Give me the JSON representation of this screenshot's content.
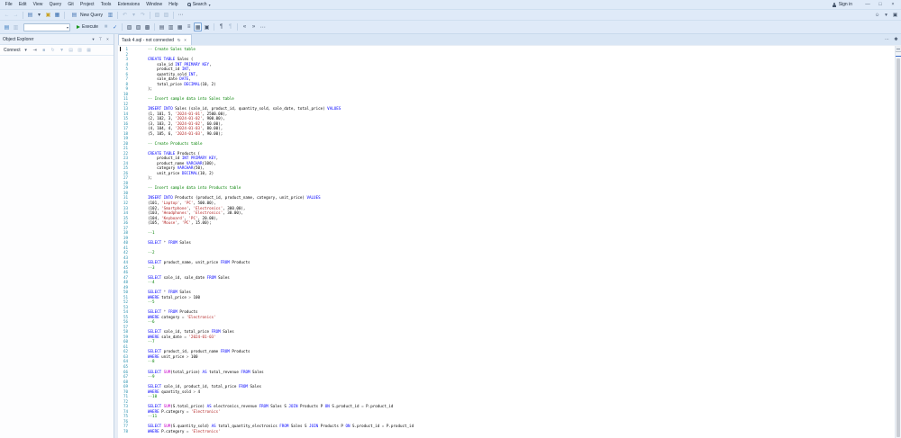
{
  "title_bar": {
    "menus": [
      "File",
      "Edit",
      "View",
      "Query",
      "Git",
      "Project",
      "Tools",
      "Extensions",
      "Window",
      "Help"
    ],
    "search_label": "Search",
    "sign_in_label": "Sign in",
    "window_controls": [
      {
        "n": "minimize-icon",
        "g": "—"
      },
      {
        "n": "maximize-icon",
        "g": "□"
      },
      {
        "n": "close-icon",
        "g": "×"
      }
    ],
    "secondary_icons": [
      {
        "n": "feedback-icon",
        "g": "☺"
      },
      {
        "n": "feedback-dropdown-icon",
        "g": "▾"
      },
      {
        "n": "connection-status-icon",
        "g": "▣"
      }
    ]
  },
  "toolbar_standard": {
    "icons_before": [
      {
        "n": "back-icon",
        "g": "←",
        "d": true
      },
      {
        "n": "forward-icon",
        "g": "→",
        "d": true
      },
      {
        "n": "separator"
      },
      {
        "n": "new-file-icon",
        "g": "▤",
        "c": "#4a7ab5"
      },
      {
        "n": "new-file-dropdown-icon",
        "g": "▾"
      },
      {
        "n": "open-file-icon",
        "g": "▣",
        "c": "#c9a227"
      },
      {
        "n": "save-icon",
        "g": "▦",
        "c": "#3a6fb0"
      },
      {
        "n": "separator"
      }
    ],
    "new_query_label": "New Query",
    "icons_after": [
      {
        "n": "new-query-current-connection-icon",
        "g": "▥",
        "c": "#4a7ab5"
      },
      {
        "n": "separator"
      },
      {
        "n": "undo-icon",
        "g": "↶",
        "d": true
      },
      {
        "n": "undo-dropdown-icon",
        "g": "▾",
        "d": true
      },
      {
        "n": "redo-icon",
        "g": "↷",
        "d": true
      },
      {
        "n": "separator"
      },
      {
        "n": "activity-monitor-icon",
        "g": "▧",
        "d": true
      },
      {
        "n": "full-screen-icon",
        "g": "▨",
        "d": true
      },
      {
        "n": "separator"
      },
      {
        "n": "toolbar-overflow-icon",
        "g": "⋯"
      }
    ]
  },
  "toolbar_query": {
    "icons_before": [
      {
        "n": "connect-database-icon",
        "g": "▤",
        "c": "#3f7fbf"
      },
      {
        "n": "change-connection-icon",
        "g": "▥",
        "d": true
      }
    ],
    "database_value": "",
    "execute_label": "Execute",
    "icons_after": [
      {
        "n": "cancel-query-icon",
        "g": "■",
        "c": "#cc8f8f",
        "d": true
      },
      {
        "n": "parse-icon",
        "g": "✓",
        "c": "#2b6cc4"
      },
      {
        "n": "separator"
      },
      {
        "n": "display-estimated-plan-icon",
        "g": "▧"
      },
      {
        "n": "live-query-statistics-icon",
        "g": "▨"
      },
      {
        "n": "query-options-icon",
        "g": "▩"
      },
      {
        "n": "separator"
      },
      {
        "n": "intellisense-enabled-icon",
        "g": "▤"
      },
      {
        "n": "include-actual-plan-icon",
        "g": "▥"
      },
      {
        "n": "include-client-statistics-icon",
        "g": "▦"
      },
      {
        "n": "results-to-text-icon",
        "g": "≡"
      },
      {
        "n": "results-to-grid-icon",
        "g": "▦",
        "sel": true
      },
      {
        "n": "results-to-file-icon",
        "g": "▣"
      },
      {
        "n": "separator"
      },
      {
        "n": "comment-icon",
        "g": "¶"
      },
      {
        "n": "uncomment-icon",
        "g": "¶",
        "d": true
      },
      {
        "n": "separator"
      },
      {
        "n": "decrease-indent-icon",
        "g": "«"
      },
      {
        "n": "increase-indent-icon",
        "g": "»"
      },
      {
        "n": "toolbar-overflow-icon",
        "g": "⋯"
      }
    ]
  },
  "object_explorer": {
    "title": "Object Explorer",
    "connect_label": "Connect",
    "header_icons": [
      {
        "n": "window-position-icon",
        "g": "▾"
      },
      {
        "n": "pin-icon",
        "g": "⊤"
      },
      {
        "n": "close-panel-icon",
        "g": "×"
      }
    ],
    "toolbar_icons": [
      {
        "n": "connect-dropdown-icon",
        "g": "▾"
      },
      {
        "n": "disconnect-icon",
        "g": "⇥"
      },
      {
        "n": "stop-icon",
        "g": "■",
        "d": true
      },
      {
        "n": "refresh-icon",
        "g": "↻",
        "d": true
      },
      {
        "n": "filter-icon",
        "g": "▼",
        "d": true
      },
      {
        "n": "script-icon",
        "g": "▤",
        "d": true
      },
      {
        "n": "reports-icon",
        "g": "▥",
        "d": true
      },
      {
        "n": "properties-icon",
        "g": "▦",
        "d": true
      }
    ]
  },
  "editor": {
    "tab_title": "Task 4.sql - not connected",
    "tab_icons": [
      {
        "n": "tab-state-icon",
        "g": "↻"
      },
      {
        "n": "tab-close-icon",
        "g": "×"
      }
    ],
    "tabrow_icons": [
      {
        "n": "tab-overflow-icon",
        "g": "⋯"
      },
      {
        "n": "editor-settings-icon",
        "g": "✽"
      }
    ],
    "colors": {
      "keyword": "#0000ff",
      "comment": "#008000",
      "string": "#b22222",
      "function": "#ca00ca",
      "operator": "#6e6e6e",
      "plain": "#000000",
      "line_number": "#2b91af"
    },
    "lines": [
      [
        [
          "c",
          "-- Create Sales table"
        ]
      ],
      [],
      [
        [
          "k",
          "CREATE TABLE"
        ],
        [
          "p",
          " Sales ("
        ]
      ],
      [
        [
          "p",
          "    sale_id "
        ],
        [
          "k",
          "INT PRIMARY KEY"
        ],
        [
          "p",
          ","
        ]
      ],
      [
        [
          "p",
          "    product_id "
        ],
        [
          "k",
          "INT"
        ],
        [
          "p",
          ","
        ]
      ],
      [
        [
          "p",
          "    quantity_sold "
        ],
        [
          "k",
          "INT"
        ],
        [
          "p",
          ","
        ]
      ],
      [
        [
          "p",
          "    sale_date "
        ],
        [
          "k",
          "DATE"
        ],
        [
          "p",
          ","
        ]
      ],
      [
        [
          "p",
          "    total_price "
        ],
        [
          "k",
          "DECIMAL"
        ],
        [
          "p",
          "(10, 2)"
        ]
      ],
      [
        [
          "p",
          ");"
        ]
      ],
      [],
      [
        [
          "c",
          "-- Insert sample data into Sales table"
        ]
      ],
      [],
      [
        [
          "k",
          "INSERT INTO"
        ],
        [
          "p",
          " Sales (sale_id, product_id, quantity_sold, sale_date, total_price) "
        ],
        [
          "k",
          "VALUES"
        ]
      ],
      [
        [
          "p",
          "(1, 101, 5, "
        ],
        [
          "s",
          "'2024-01-01'"
        ],
        [
          "p",
          ", 2500.00),"
        ]
      ],
      [
        [
          "p",
          "(2, 102, 3, "
        ],
        [
          "s",
          "'2024-01-02'"
        ],
        [
          "p",
          ", 900.00),"
        ]
      ],
      [
        [
          "p",
          "(3, 103, 2, "
        ],
        [
          "s",
          "'2024-01-02'"
        ],
        [
          "p",
          ", 60.00),"
        ]
      ],
      [
        [
          "p",
          "(4, 104, 4, "
        ],
        [
          "s",
          "'2024-01-03'"
        ],
        [
          "p",
          ", 80.00),"
        ]
      ],
      [
        [
          "p",
          "(5, 105, 6, "
        ],
        [
          "s",
          "'2024-01-03'"
        ],
        [
          "p",
          ", 90.00);"
        ]
      ],
      [],
      [
        [
          "c",
          "-- Create Products table"
        ]
      ],
      [],
      [
        [
          "k",
          "CREATE TABLE"
        ],
        [
          "p",
          " Products ("
        ]
      ],
      [
        [
          "p",
          "    product_id "
        ],
        [
          "k",
          "INT PRIMARY KEY"
        ],
        [
          "p",
          ","
        ]
      ],
      [
        [
          "p",
          "    product_name "
        ],
        [
          "k",
          "VARCHAR"
        ],
        [
          "p",
          "(100),"
        ]
      ],
      [
        [
          "p",
          "    category "
        ],
        [
          "k",
          "VARCHAR"
        ],
        [
          "p",
          "(50),"
        ]
      ],
      [
        [
          "p",
          "    unit_price "
        ],
        [
          "k",
          "DECIMAL"
        ],
        [
          "p",
          "(10, 2)"
        ]
      ],
      [
        [
          "p",
          ");"
        ]
      ],
      [],
      [
        [
          "c",
          "-- Insert sample data into Products table"
        ]
      ],
      [],
      [
        [
          "k",
          "INSERT INTO"
        ],
        [
          "p",
          " Products (product_id, product_name, category, unit_price) "
        ],
        [
          "k",
          "VALUES"
        ]
      ],
      [
        [
          "p",
          "(101, "
        ],
        [
          "s",
          "'Laptop'"
        ],
        [
          "p",
          ", "
        ],
        [
          "s",
          "'PC'"
        ],
        [
          "p",
          ", 500.00),"
        ]
      ],
      [
        [
          "p",
          "(102, "
        ],
        [
          "s",
          "'Smartphone'"
        ],
        [
          "p",
          ", "
        ],
        [
          "s",
          "'Electronics'"
        ],
        [
          "p",
          ", 300.00),"
        ]
      ],
      [
        [
          "p",
          "(103, "
        ],
        [
          "s",
          "'Headphones'"
        ],
        [
          "p",
          ", "
        ],
        [
          "s",
          "'Electronics'"
        ],
        [
          "p",
          ", 30.00),"
        ]
      ],
      [
        [
          "p",
          "(104, "
        ],
        [
          "s",
          "'Keyboard'"
        ],
        [
          "p",
          ", "
        ],
        [
          "s",
          "'PC'"
        ],
        [
          "p",
          ", 20.00),"
        ]
      ],
      [
        [
          "p",
          "(105, "
        ],
        [
          "s",
          "'Mouse'"
        ],
        [
          "p",
          ", "
        ],
        [
          "s",
          "'PC'"
        ],
        [
          "p",
          ", 15.00);"
        ]
      ],
      [],
      [
        [
          "c",
          "--1"
        ]
      ],
      [],
      [
        [
          "k",
          "SELECT"
        ],
        [
          "o",
          " * "
        ],
        [
          "k",
          "FROM"
        ],
        [
          "p",
          " Sales"
        ]
      ],
      [],
      [
        [
          "c",
          "--2"
        ]
      ],
      [],
      [
        [
          "k",
          "SELECT"
        ],
        [
          "p",
          " product_name, unit_price "
        ],
        [
          "k",
          "FROM"
        ],
        [
          "p",
          " Products"
        ]
      ],
      [
        [
          "c",
          "--3"
        ]
      ],
      [],
      [
        [
          "k",
          "SELECT"
        ],
        [
          "p",
          " sale_id, sale_date "
        ],
        [
          "k",
          "FROM"
        ],
        [
          "p",
          " Sales"
        ]
      ],
      [
        [
          "c",
          "--4"
        ]
      ],
      [],
      [
        [
          "k",
          "SELECT"
        ],
        [
          "o",
          " * "
        ],
        [
          "k",
          "FROM"
        ],
        [
          "p",
          " Sales"
        ]
      ],
      [
        [
          "k",
          "WHERE"
        ],
        [
          "p",
          " total_price "
        ],
        [
          "o",
          ">"
        ],
        [
          "p",
          " 100"
        ]
      ],
      [
        [
          "c",
          "--5"
        ]
      ],
      [],
      [
        [
          "k",
          "SELECT"
        ],
        [
          "o",
          " * "
        ],
        [
          "k",
          "FROM"
        ],
        [
          "p",
          " Products"
        ]
      ],
      [
        [
          "k",
          "WHERE"
        ],
        [
          "p",
          " category "
        ],
        [
          "o",
          "="
        ],
        [
          "p",
          " "
        ],
        [
          "s",
          "'Electronics'"
        ]
      ],
      [
        [
          "c",
          "--6"
        ]
      ],
      [],
      [
        [
          "k",
          "SELECT"
        ],
        [
          "p",
          " sale_id, total_price "
        ],
        [
          "k",
          "FROM"
        ],
        [
          "p",
          " Sales"
        ]
      ],
      [
        [
          "k",
          "WHERE"
        ],
        [
          "p",
          " sale_date "
        ],
        [
          "o",
          "="
        ],
        [
          "p",
          " "
        ],
        [
          "s",
          "'2024-01-03'"
        ]
      ],
      [
        [
          "c",
          "--7"
        ]
      ],
      [],
      [
        [
          "k",
          "SELECT"
        ],
        [
          "p",
          " product_id, product_name "
        ],
        [
          "k",
          "FROM"
        ],
        [
          "p",
          " Products"
        ]
      ],
      [
        [
          "k",
          "WHERE"
        ],
        [
          "p",
          " unit_price "
        ],
        [
          "o",
          ">"
        ],
        [
          "p",
          " 100"
        ]
      ],
      [
        [
          "c",
          "--8"
        ]
      ],
      [],
      [
        [
          "k",
          "SELECT"
        ],
        [
          "p",
          " "
        ],
        [
          "f",
          "SUM"
        ],
        [
          "p",
          "(total_price) "
        ],
        [
          "k",
          "AS"
        ],
        [
          "p",
          " total_revenue "
        ],
        [
          "k",
          "FROM"
        ],
        [
          "p",
          " Sales"
        ]
      ],
      [
        [
          "c",
          "--9"
        ]
      ],
      [],
      [
        [
          "k",
          "SELECT"
        ],
        [
          "p",
          " sale_id, product_id, total_price "
        ],
        [
          "k",
          "FROM"
        ],
        [
          "p",
          " Sales"
        ]
      ],
      [
        [
          "k",
          "WHERE"
        ],
        [
          "p",
          " quantity_sold "
        ],
        [
          "o",
          ">"
        ],
        [
          "p",
          " 4"
        ]
      ],
      [
        [
          "c",
          "--10"
        ]
      ],
      [],
      [
        [
          "k",
          "SELECT"
        ],
        [
          "p",
          " "
        ],
        [
          "f",
          "SUM"
        ],
        [
          "p",
          "(S.total_price) "
        ],
        [
          "k",
          "AS"
        ],
        [
          "p",
          " electronics_revenue "
        ],
        [
          "k",
          "FROM"
        ],
        [
          "p",
          " Sales S "
        ],
        [
          "k",
          "JOIN"
        ],
        [
          "p",
          " Products P "
        ],
        [
          "k",
          "ON"
        ],
        [
          "p",
          " S.product_id "
        ],
        [
          "o",
          "="
        ],
        [
          "p",
          " P.product_id"
        ]
      ],
      [
        [
          "k",
          "WHERE"
        ],
        [
          "p",
          " P.category "
        ],
        [
          "o",
          "="
        ],
        [
          "p",
          " "
        ],
        [
          "s",
          "'Electronics'"
        ]
      ],
      [
        [
          "c",
          "--11"
        ]
      ],
      [],
      [
        [
          "k",
          "SELECT"
        ],
        [
          "p",
          " "
        ],
        [
          "f",
          "SUM"
        ],
        [
          "p",
          "(S.quantity_sold) "
        ],
        [
          "k",
          "AS"
        ],
        [
          "p",
          " total_quantity_electronics "
        ],
        [
          "k",
          "FROM"
        ],
        [
          "p",
          " Sales S "
        ],
        [
          "k",
          "JOIN"
        ],
        [
          "p",
          " Products P "
        ],
        [
          "k",
          "ON"
        ],
        [
          "p",
          " S.product_id "
        ],
        [
          "o",
          "="
        ],
        [
          "p",
          " P.product_id"
        ]
      ],
      [
        [
          "k",
          "WHERE"
        ],
        [
          "p",
          " P.category "
        ],
        [
          "o",
          "="
        ],
        [
          "p",
          " "
        ],
        [
          "s",
          "'Electronics'"
        ]
      ]
    ]
  }
}
